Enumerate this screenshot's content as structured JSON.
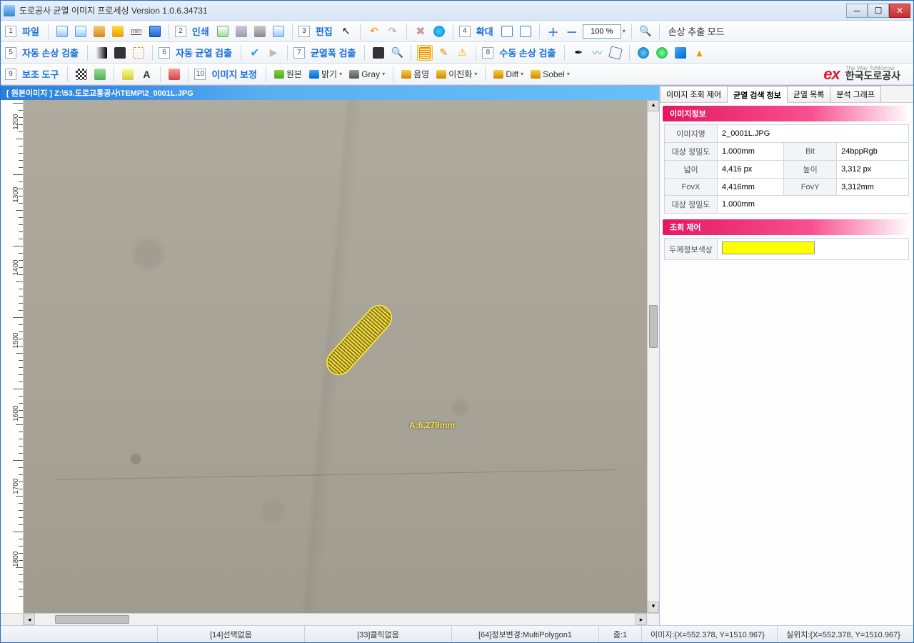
{
  "window": {
    "title": "도로공사 균열 이미지 프로세싱 Version 1.0.6.34731"
  },
  "toolbar1": {
    "m1_num": "1",
    "m1": "파일",
    "m2_num": "2",
    "m2": "인쇄",
    "m3_num": "3",
    "m3": "편집",
    "m4_num": "4",
    "m4": "확대",
    "zoom": "100 %",
    "mode": "손상 추출 모드"
  },
  "toolbar2": {
    "m5_num": "5",
    "m5": "자동 손상 검출",
    "m6_num": "6",
    "m6": "자동 균열 검출",
    "m7_num": "7",
    "m7": "균열폭 검출",
    "m8_num": "8",
    "m8": "수동 손상 검출"
  },
  "toolbar3": {
    "m9_num": "9",
    "m9": "보조 도구",
    "m10_num": "10",
    "m10": "이미지 보정",
    "b1": "원본",
    "b2": "밝기",
    "b3": "Gray",
    "b4": "음영",
    "b5": "이진화",
    "b6": "Diff",
    "b7": "Sobel",
    "company": "한국도로공사",
    "ex": "ex",
    "slogan": "The Way ToMorrow"
  },
  "image_header": "[ 원본이미지 ]  Z:\\53.도로교통공사\\TEMP\\2_0001L.JPG",
  "ruler": {
    "t1": "1200",
    "t2": "1300",
    "t3": "1400",
    "t4": "1500",
    "t5": "1600",
    "t6": "1700",
    "t7": "1800"
  },
  "annotation": {
    "label": "A:6,279mm"
  },
  "tabs": {
    "t1": "이미지 조회 제어",
    "t2": "균열 검색 정보",
    "t3": "균열 목록",
    "t4": "분석 그래프"
  },
  "panel": {
    "hdr1": "이미지정보",
    "r1l": "이미지명",
    "r1v": "2_0001L.JPG",
    "r2l": "대상 정밀도",
    "r2v": "1.000mm",
    "r2l2": "Bit",
    "r2v2": "24bppRgb",
    "r3l": "넓이",
    "r3v": "4,416 px",
    "r3l2": "높이",
    "r3v2": "3,312 px",
    "r4l": "FovX",
    "r4v": "4,416mm",
    "r4l2": "FovY",
    "r4v2": "3,312mm",
    "r5l": "대상 정밀도",
    "r5v": "1.000mm",
    "hdr2": "조회 제어",
    "r6l": "두께정보색상"
  },
  "status": {
    "s1": "[14]선택없음",
    "s2": "[33]클릭없음",
    "s3": "[64]정보변경:MultiPolygon1",
    "s4": "줌:1",
    "s5": "이미지:{X=552.378, Y=1510.967}",
    "s6": "실위치:{X=552.378, Y=1510.967}"
  }
}
